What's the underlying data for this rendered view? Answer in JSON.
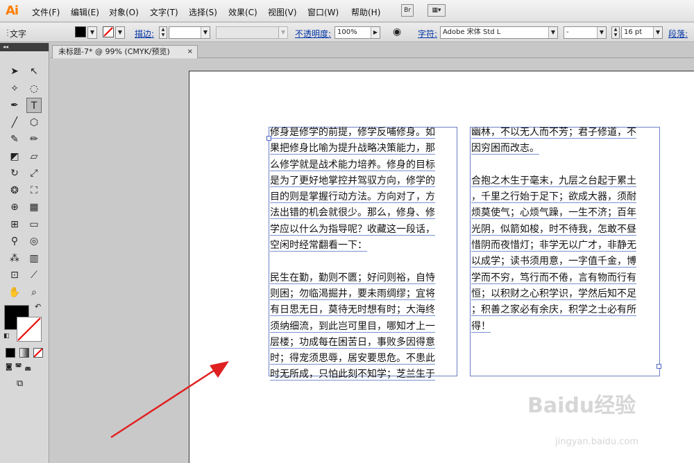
{
  "app": {
    "logo": "Ai"
  },
  "menubar": {
    "items": [
      "文件(F)",
      "编辑(E)",
      "对象(O)",
      "文字(T)",
      "选择(S)",
      "效果(C)",
      "视图(V)",
      "窗口(W)",
      "帮助(H)"
    ],
    "bridge_label": "Br"
  },
  "control_bar": {
    "tool_label": "文字",
    "fill_color": "#000000",
    "stroke_label": "描边:",
    "opacity_label": "不透明度:",
    "opacity_value": "100%",
    "char_label": "字符:",
    "font_family": "Adobe 宋体 Std L",
    "font_style": "-",
    "font_size": "16 pt",
    "para_label": "段落:"
  },
  "tools": [
    {
      "name": "selection-tool-icon",
      "glyph": "➤"
    },
    {
      "name": "direct-selection-tool-icon",
      "glyph": "↖"
    },
    {
      "name": "magic-wand-tool-icon",
      "glyph": "✧"
    },
    {
      "name": "lasso-tool-icon",
      "glyph": "◌"
    },
    {
      "name": "pen-tool-icon",
      "glyph": "✒"
    },
    {
      "name": "type-tool-icon",
      "glyph": "T"
    },
    {
      "name": "line-tool-icon",
      "glyph": "╱"
    },
    {
      "name": "shape-tool-icon",
      "glyph": "⬡"
    },
    {
      "name": "paintbrush-tool-icon",
      "glyph": "✎"
    },
    {
      "name": "pencil-tool-icon",
      "glyph": "✏"
    },
    {
      "name": "blob-brush-tool-icon",
      "glyph": "◩"
    },
    {
      "name": "eraser-tool-icon",
      "glyph": "▱"
    },
    {
      "name": "rotate-tool-icon",
      "glyph": "↻"
    },
    {
      "name": "scale-tool-icon",
      "glyph": "⤢"
    },
    {
      "name": "warp-tool-icon",
      "glyph": "❂"
    },
    {
      "name": "free-transform-tool-icon",
      "glyph": "⛶"
    },
    {
      "name": "shape-builder-tool-icon",
      "glyph": "⊕"
    },
    {
      "name": "perspective-grid-tool-icon",
      "glyph": "▦"
    },
    {
      "name": "mesh-tool-icon",
      "glyph": "⊞"
    },
    {
      "name": "gradient-tool-icon",
      "glyph": "▭"
    },
    {
      "name": "eyedropper-tool-icon",
      "glyph": "⚲"
    },
    {
      "name": "blend-tool-icon",
      "glyph": "◎"
    },
    {
      "name": "symbol-sprayer-tool-icon",
      "glyph": "⁂"
    },
    {
      "name": "column-graph-tool-icon",
      "glyph": "▥"
    },
    {
      "name": "artboard-tool-icon",
      "glyph": "⊡"
    },
    {
      "name": "slice-tool-icon",
      "glyph": "⟋"
    },
    {
      "name": "hand-tool-icon",
      "glyph": "✋"
    },
    {
      "name": "zoom-tool-icon",
      "glyph": "⌕"
    }
  ],
  "tab": {
    "title": "未标题-7* @ 99% (CMYK/预览)",
    "close": "×"
  },
  "text_col1": [
    "修身是修学的前提，修学反哺修身。如",
    "果把修身比喻为提升战略决策能力，那",
    "么修学就是战术能力培养。修身的目标",
    "是为了更好地掌控并驾驭方向，修学的",
    "目的则是掌握行动方法。方向对了，方",
    "法出错的机会就很少。那么，修身、修",
    "学应以什么为指导呢？收藏这一段话，",
    "空闲时经常翻看一下：",
    "",
    "民生在勤，勤则不匮；好问则裕，自恃",
    "则困；勿临渴掘井，要未雨绸缪；宜将",
    "有日思无日，莫待无时想有时；大海终",
    "须纳细流，到此岂可里目，哪知才上一",
    "层楼；功成每在困苦日，事败多因得意",
    "时；得宠须思辱，居安要思危。不患此",
    "时无所成，只怕此刻不知学；芝兰生于"
  ],
  "text_col2": [
    "幽林，不以无人而不芳；君子修道，不",
    "因穷困而改志。",
    "",
    "合抱之木生于毫末，九层之台起于累土",
    "，千里之行始于足下；欲成大器，须耐",
    "烦莫使气；心烦气躁，一生不济；百年",
    "光阴，似箭如梭，时不待我，怎敢不昼",
    "惜阴而夜惜灯；非学无以广才，非静无",
    "以成学；读书须用意，一字值千金，博",
    "学而不穷，笃行而不倦，言有物而行有",
    "恒；以积财之心积学识，学然后知不足",
    "；积善之家必有余庆，积学之士必有所",
    "得！"
  ],
  "watermark": {
    "brand": "Baidu经验",
    "url": "jingyan.baidu.com"
  },
  "colors": {
    "logo": "#ff7d00",
    "arrow": "#e02020",
    "selection": "#4a64c0"
  }
}
